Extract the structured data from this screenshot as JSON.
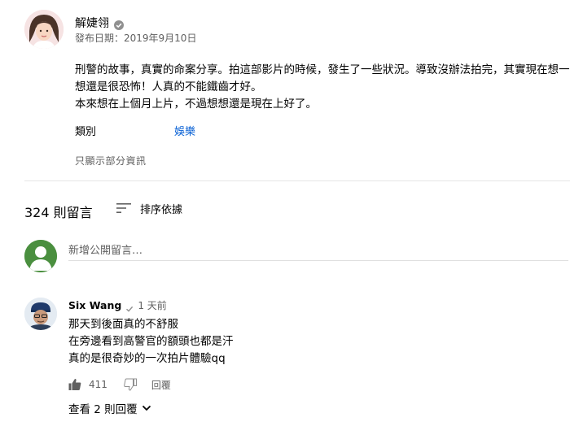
{
  "channel": {
    "name": "解婕翎",
    "verified": true,
    "published": "發布日期：2019年9月10日"
  },
  "description": {
    "lines": [
      "刑警的故事，真實的命案分享。拍這部影片的時候，發生了一些狀況。導致沒辦法拍完，其實現在想一",
      "想還是很恐怖！人真的不能鐵齒才好。",
      "本來想在上個月上片，不過想想還是現在上好了。"
    ],
    "category_label": "類別",
    "category_value": "娛樂",
    "show_less": "只顯示部分資訊"
  },
  "comments_section": {
    "count_label": "324 則留言",
    "sort_label": "排序依據",
    "sort_icon": "sort-icon",
    "new_comment_placeholder": "新增公開留言…"
  },
  "comment": {
    "author": "Six Wang",
    "time": "1 天前",
    "lines": [
      "那天到後面真的不舒服",
      "在旁邊看到高警官的額頭也都是汗",
      "真的是很奇妙的一次拍片體驗qq"
    ],
    "likes": "411",
    "reply_label": "回覆",
    "view_replies_label": "查看 2 則回覆"
  },
  "colors": {
    "link": "#065fd4",
    "secondary_text": "#606060",
    "primary_text": "#030303",
    "divider": "#e5e5e5",
    "default_avatar": "#4a8f3f"
  }
}
